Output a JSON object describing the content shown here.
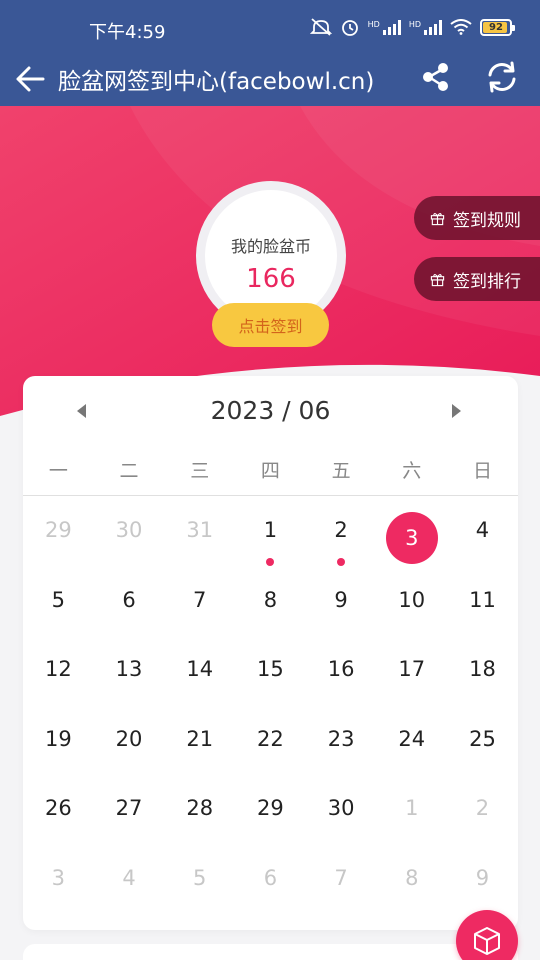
{
  "status_bar": {
    "time": "下午4:59",
    "battery": "92"
  },
  "nav": {
    "title": "脸盆网签到中心(facebowl.cn)"
  },
  "hero": {
    "coin_label": "我的脸盆币",
    "coin_value": "166",
    "signin_label": "点击签到",
    "rules_label": "签到规则",
    "ranking_label": "签到排行"
  },
  "calendar": {
    "month": "2023 / 06",
    "weekdays": [
      "一",
      "二",
      "三",
      "四",
      "五",
      "六",
      "日"
    ],
    "days": [
      {
        "n": "29",
        "out": true
      },
      {
        "n": "30",
        "out": true
      },
      {
        "n": "31",
        "out": true
      },
      {
        "n": "1",
        "dot": true
      },
      {
        "n": "2",
        "dot": true
      },
      {
        "n": "3",
        "today": true
      },
      {
        "n": "4"
      },
      {
        "n": "5"
      },
      {
        "n": "6"
      },
      {
        "n": "7"
      },
      {
        "n": "8"
      },
      {
        "n": "9"
      },
      {
        "n": "10"
      },
      {
        "n": "11"
      },
      {
        "n": "12"
      },
      {
        "n": "13"
      },
      {
        "n": "14"
      },
      {
        "n": "15"
      },
      {
        "n": "16"
      },
      {
        "n": "17"
      },
      {
        "n": "18"
      },
      {
        "n": "19"
      },
      {
        "n": "20"
      },
      {
        "n": "21"
      },
      {
        "n": "22"
      },
      {
        "n": "23"
      },
      {
        "n": "24"
      },
      {
        "n": "25"
      },
      {
        "n": "26"
      },
      {
        "n": "27"
      },
      {
        "n": "28"
      },
      {
        "n": "29"
      },
      {
        "n": "30"
      },
      {
        "n": "1",
        "out": true
      },
      {
        "n": "2",
        "out": true
      },
      {
        "n": "3",
        "out": true
      },
      {
        "n": "4",
        "out": true
      },
      {
        "n": "5",
        "out": true
      },
      {
        "n": "6",
        "out": true
      },
      {
        "n": "7",
        "out": true
      },
      {
        "n": "8",
        "out": true
      },
      {
        "n": "9",
        "out": true
      }
    ]
  },
  "colors": {
    "nav": "#3a5796",
    "accent": "#ee2a62",
    "button": "#f8c840",
    "pill": "#6e122e"
  },
  "icons": {
    "back": "arrow-left-icon",
    "share": "share-icon",
    "refresh": "refresh-icon",
    "gift": "gift-icon",
    "fab": "cube-icon",
    "mute": "mute-icon",
    "alarm": "alarm-icon",
    "wifi": "wifi-icon"
  }
}
